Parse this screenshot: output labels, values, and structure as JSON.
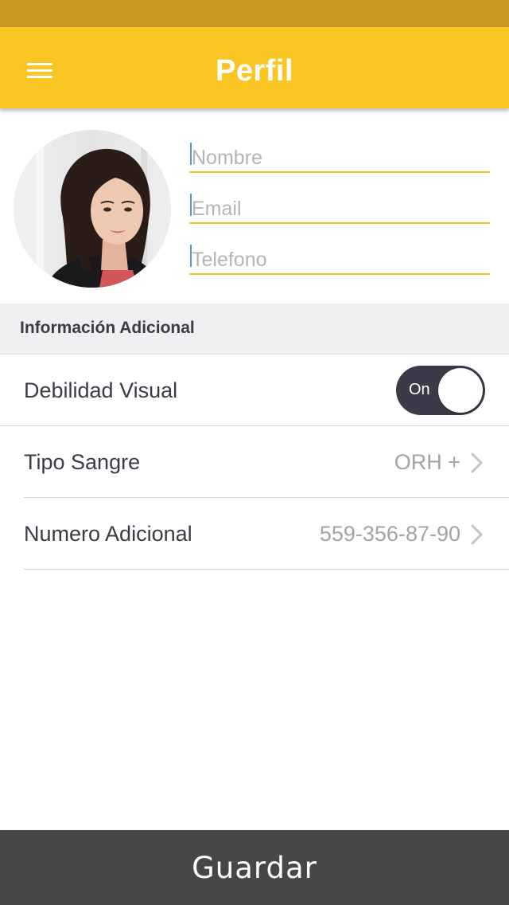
{
  "header": {
    "title": "Perfil",
    "menu_icon": "hamburger-menu-icon"
  },
  "profile": {
    "avatar_icon": "user-photo",
    "fields": {
      "name": {
        "placeholder": "Nombre",
        "value": ""
      },
      "email": {
        "placeholder": "Email",
        "value": ""
      },
      "phone": {
        "placeholder": "Telefono",
        "value": ""
      }
    }
  },
  "section": {
    "title": "Información Adicional"
  },
  "settings": {
    "visual": {
      "label": "Debilidad Visual",
      "toggle_text": "On",
      "enabled": true
    },
    "blood": {
      "label": "Tipo Sangre",
      "value": "ORH +",
      "icon": "chevron-right-icon"
    },
    "extra_number": {
      "label": "Numero Adicional",
      "value": "559-356-87-90",
      "icon": "chevron-right-icon"
    }
  },
  "footer": {
    "save_label": "Guardar"
  },
  "colors": {
    "status_bar": "#c89923",
    "app_bar": "#f9c624",
    "field_underline": "#f2c12e",
    "toggle_on": "#3a3a48",
    "save_button": "#474747"
  }
}
